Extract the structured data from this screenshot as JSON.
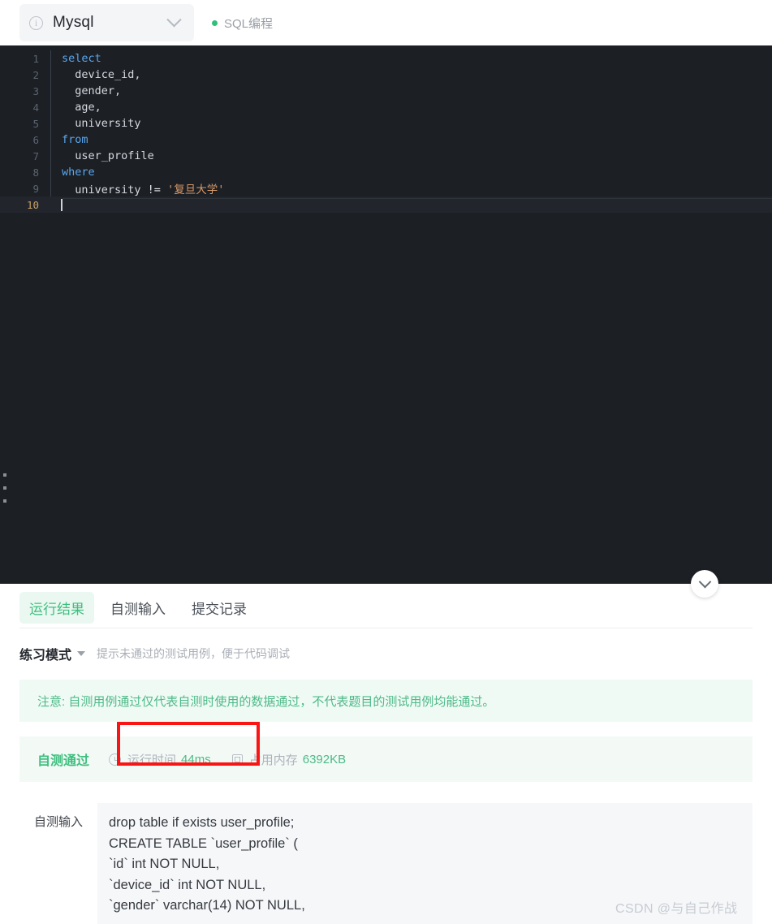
{
  "topbar": {
    "db_selector": {
      "info_icon": "info-circle-icon",
      "value": "Mysql",
      "chevron": "chevron-down-icon"
    },
    "tag": {
      "dot_color": "#30c07a",
      "label": "SQL编程"
    }
  },
  "editor": {
    "theme_bg": "#1c1f24",
    "lines": [
      {
        "no": "1",
        "segments": [
          {
            "t": "select",
            "c": "kw"
          }
        ]
      },
      {
        "no": "2",
        "segments": [
          {
            "t": "  device_id,",
            "c": ""
          }
        ]
      },
      {
        "no": "3",
        "segments": [
          {
            "t": "  gender,",
            "c": ""
          }
        ]
      },
      {
        "no": "4",
        "segments": [
          {
            "t": "  age,",
            "c": ""
          }
        ]
      },
      {
        "no": "5",
        "segments": [
          {
            "t": "  university",
            "c": ""
          }
        ]
      },
      {
        "no": "6",
        "segments": [
          {
            "t": "from",
            "c": "kw"
          }
        ]
      },
      {
        "no": "7",
        "segments": [
          {
            "t": "  user_profile",
            "c": ""
          }
        ]
      },
      {
        "no": "8",
        "segments": [
          {
            "t": "where",
            "c": "kw"
          }
        ]
      },
      {
        "no": "9",
        "segments": [
          {
            "t": "  university ",
            "c": ""
          },
          {
            "t": "!=",
            "c": "op"
          },
          {
            "t": " ",
            "c": ""
          },
          {
            "t": "'复旦大学'",
            "c": "str"
          }
        ]
      },
      {
        "no": "10",
        "segments": []
      }
    ],
    "full_code": "select\n  device_id,\n  gender,\n  age,\n  university\nfrom\n  user_profile\nwhere\n  university != '复旦大学'\n",
    "drag_handle": "resize-handle",
    "collapse_button": "chevron-down-icon"
  },
  "result": {
    "tabs": [
      {
        "label": "运行结果",
        "active": true
      },
      {
        "label": "自测输入",
        "active": false
      },
      {
        "label": "提交记录",
        "active": false
      }
    ],
    "mode": {
      "name": "练习模式",
      "caret": "caret-down-icon",
      "hint": "提示未通过的测试用例，便于代码调试"
    },
    "notice": "注意: 自测用例通过仅代表自测时使用的数据通过，不代表题目的测试用例均能通过。",
    "status": {
      "verdict": "自测通过",
      "metrics": [
        {
          "icon": "clock-icon",
          "label": "运行时间",
          "value": "44ms",
          "highlighted": true
        },
        {
          "icon": "cpu-icon",
          "label": "占用内存",
          "value": "6392KB",
          "highlighted": false
        }
      ],
      "annotation_color": "#fb1414"
    },
    "self_input": {
      "label": "自测输入",
      "lines": [
        "drop table if exists user_profile;",
        "CREATE TABLE `user_profile` (",
        "`id` int NOT NULL,",
        "`device_id` int NOT NULL,",
        "`gender` varchar(14) NOT NULL,"
      ]
    }
  },
  "watermark": "CSDN @与自己作战"
}
